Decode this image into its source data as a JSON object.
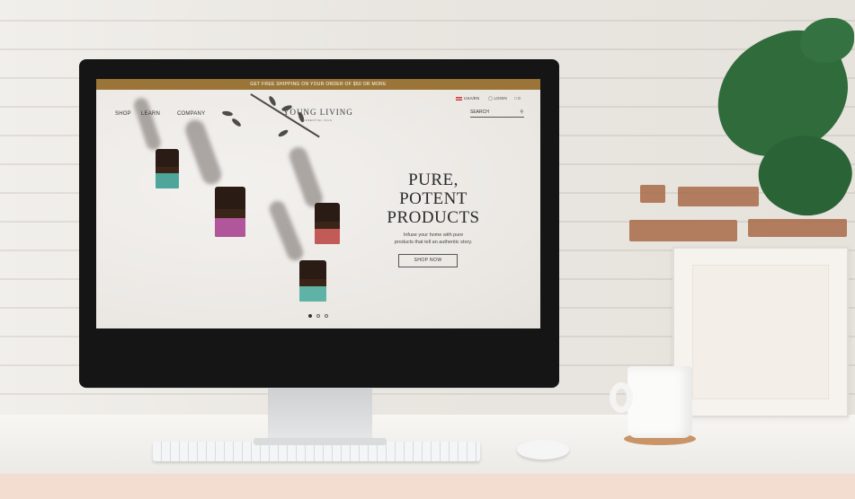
{
  "promo_bar": {
    "text": "GET FREE SHIPPING ON YOUR ORDER OF $50 OR MORE",
    "color": "#9a7537"
  },
  "header": {
    "nav": [
      "SHOP",
      "LEARN",
      "COMPANY"
    ],
    "logo": {
      "name": "YOUNG LIVING",
      "tagline": "ESSENTIAL OILS"
    },
    "locale": "USA/EN",
    "login": "LOGIN",
    "cart_count": "0",
    "search_placeholder": "SEARCH"
  },
  "hero": {
    "headline_line1": "PURE,",
    "headline_line2": "POTENT",
    "headline_line3": "PRODUCTS",
    "subtext_line1": "Infuse your home with pure",
    "subtext_line2": "products that tell an authentic story.",
    "cta": "SHOP NOW",
    "carousel_dots": 3,
    "active_dot": 1
  },
  "icons": {
    "flag": "us-flag-icon",
    "login": "user-icon",
    "cart": "bag-icon",
    "search": "search-icon"
  }
}
